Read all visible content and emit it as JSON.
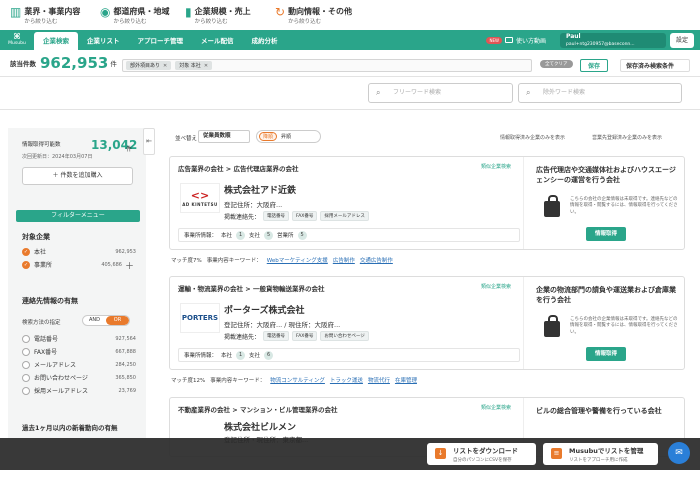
{
  "header": {
    "logo": "Musubu",
    "nav": [
      "企業検索",
      "企業リスト",
      "アプローチ管理",
      "メール配信",
      "成約分析"
    ],
    "new_badge": "NEW",
    "guide": "使い方動画",
    "user_name": "Paul",
    "user_id": "paul+ntg230957@baseconn...",
    "settings": "設定"
  },
  "count": {
    "label": "該当件数",
    "value": "962,953",
    "unit": "件"
  },
  "chips": [
    {
      "label": "部外項目あり"
    },
    {
      "label": "対象  本社"
    }
  ],
  "clear_label": "全てクリア",
  "save_label": "保存",
  "saved_list_label": "保存済み検索条件",
  "categories": [
    {
      "title": "業界・事業内容",
      "sub": "から絞り込む"
    },
    {
      "title": "都道府県・地域",
      "sub": "から絞り込む"
    },
    {
      "title": "企業規模・売上",
      "sub": "から絞り込む"
    },
    {
      "title": "動向情報・その他",
      "sub": "から絞り込む"
    }
  ],
  "search": {
    "free_placeholder": "フリーワード検索",
    "exclude_placeholder": "除外ワード検索"
  },
  "sidebar": {
    "info_label": "情報取得可能数",
    "info_value": "13,042",
    "info_unit": "件",
    "updated": "次回更新日：2024年03月07日",
    "add_button": "件数を追加購入",
    "filter_menu": "フィルターメニュー",
    "target_title": "対象企業",
    "targets": [
      {
        "label": "本社",
        "count": "962,953"
      },
      {
        "label": "事業所",
        "count": "405,686"
      }
    ],
    "contact_title": "連絡先情報の有無",
    "contact_type": "検索方法の指定",
    "and": "AND",
    "or": "OR",
    "contacts": [
      {
        "label": "電話番号",
        "count": "927,564"
      },
      {
        "label": "FAX番号",
        "count": "667,888"
      },
      {
        "label": "メールアドレス",
        "count": "284,250"
      },
      {
        "label": "お問い合わせページ",
        "count": "365,850"
      },
      {
        "label": "採用メールアドレス",
        "count": "23,769"
      }
    ],
    "trend_title": "過去1ヶ月以内の新着動向の有無"
  },
  "sort": {
    "label": "並べ替え",
    "value": "従業員数順",
    "toggle_on": "降順",
    "toggle_off": "昇順"
  },
  "checks": [
    "情報取得済み企業のみを表示",
    "営業先登録済み企業のみを表示"
  ],
  "cards": [
    {
      "industry": "広告業界の会社  >  広告代理店業界の会社",
      "clip": "類似企業検索",
      "logo": "AD KINTETSU",
      "name": "株式会社アド近鉄",
      "addr": "登記住所：大阪府...",
      "pub": "掲載連絡先：",
      "tags": [
        "電話番号",
        "FAX番号",
        "採用メールアドレス"
      ],
      "offices_label": "事業所情報：",
      "offices": [
        {
          "t": "本社",
          "n": "1"
        },
        {
          "t": "支社",
          "n": "5"
        },
        {
          "t": "営業所",
          "n": "5"
        }
      ],
      "right_title": "広告代理店や交通媒体社およびハウスエージェンシーの運営を行う会社",
      "lock_text": "こちらの会社の企業情報は未取得です。連絡先などの情報を取得・閲覧するには、情報取得を行ってください。",
      "get": "情報取得",
      "match": "マッチ度7%",
      "kw_label": "事業内容キーワード：",
      "kws": [
        "Webマーケティング支援",
        "広告制作",
        "交通広告制作"
      ]
    },
    {
      "industry": "運輸・物流業界の会社  >  一般貨物輸送業界の会社",
      "clip": "類似企業検索",
      "logo": "PORTERS",
      "name": "ポーターズ株式会社",
      "addr": "登記住所：大阪府... / 現住所：大阪府...",
      "pub": "掲載連絡先：",
      "tags": [
        "電話番号",
        "FAX番号",
        "お問い合わせページ"
      ],
      "offices_label": "事業所情報：",
      "offices": [
        {
          "t": "本社",
          "n": "1"
        },
        {
          "t": "支社",
          "n": "6"
        }
      ],
      "right_title": "企業の物流部門の請負や運送業および倉庫業を行う会社",
      "lock_text": "こちらの会社の企業情報は未取得です。連絡先などの情報を取得・閲覧するには、情報取得を行ってください。",
      "get": "情報取得",
      "match": "マッチ度12%",
      "kw_label": "事業内容キーワード：",
      "kws": [
        "物流コンサルティング",
        "トラック運送",
        "物流代行",
        "在庫管理"
      ]
    },
    {
      "industry": "不動産業界の会社  >  マンション・ビル管理業界の会社",
      "clip": "類似企業検索",
      "name": "株式会社ビルメン",
      "addr": "登記住所・現住所：東京都...",
      "right_title": "ビルの総合管理や警備を行っている会社"
    }
  ],
  "bottom": {
    "label": "企業検索：",
    "value": "962,953",
    "unit": "社",
    "dl_title": "リストをダウンロード",
    "dl_sub": "自分のパソコンにCSVを保存",
    "mg_title": "Musubuでリストを管理",
    "mg_sub": "リストをアプローチ用に作成"
  }
}
